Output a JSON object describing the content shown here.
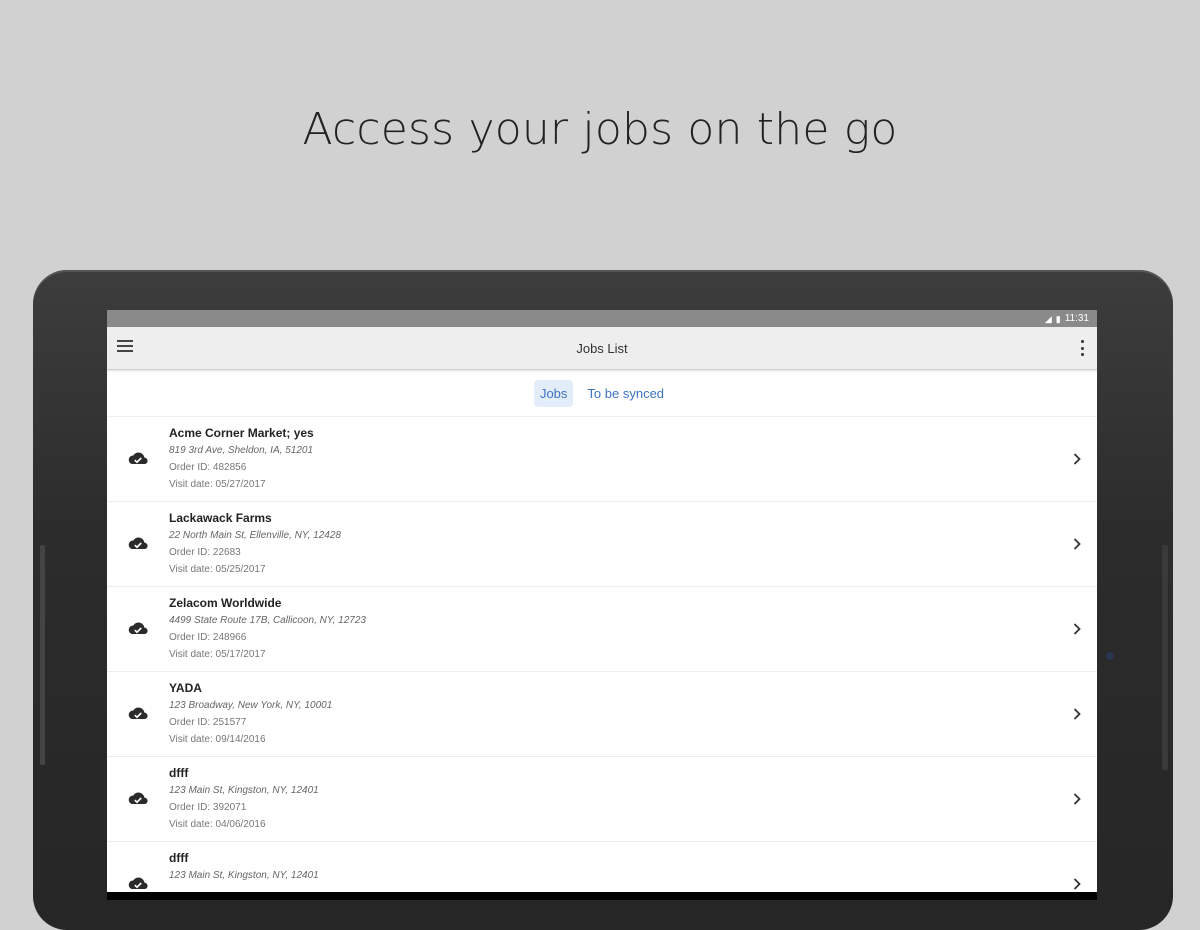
{
  "headline": "Access your jobs on the go",
  "status_bar": {
    "time": "11:31",
    "icons": [
      "signal-off-icon",
      "battery-icon"
    ]
  },
  "app_bar": {
    "title": "Jobs List",
    "menu_icon": "hamburger-menu-icon",
    "overflow_icon": "overflow-menu-icon"
  },
  "tabs": [
    {
      "label": "Jobs",
      "active": true
    },
    {
      "label": "To be synced",
      "active": false
    }
  ],
  "jobs": [
    {
      "name": "Acme Corner Market; yes",
      "address": "819 3rd Ave, Sheldon, IA, 51201",
      "order": "Order ID: 482856",
      "visit": "Visit date: 05/27/2017"
    },
    {
      "name": "Lackawack Farms",
      "address": "22 North Main St, Ellenville, NY, 12428",
      "order": "Order ID: 22683",
      "visit": "Visit date: 05/25/2017"
    },
    {
      "name": "Zelacom Worldwide",
      "address": "4499 State Route 17B, Callicoon, NY, 12723",
      "order": "Order ID: 248966",
      "visit": "Visit date: 05/17/2017"
    },
    {
      "name": "YADA",
      "address": "123 Broadway, New York, NY, 10001",
      "order": "Order ID: 251577",
      "visit": "Visit date: 09/14/2016"
    },
    {
      "name": "dfff",
      "address": "123 Main St, Kingston, NY, 12401",
      "order": "Order ID: 392071",
      "visit": "Visit date: 04/06/2016"
    },
    {
      "name": "dfff",
      "address": "123 Main St, Kingston, NY, 12401",
      "order": "",
      "visit": ""
    }
  ],
  "colors": {
    "background": "#d1d1d1",
    "tab_accent": "#3d74c4",
    "tab_active_bg": "#e3edf9",
    "app_bar_bg": "#eeeeee",
    "status_bar_bg": "#8a8a8a"
  }
}
